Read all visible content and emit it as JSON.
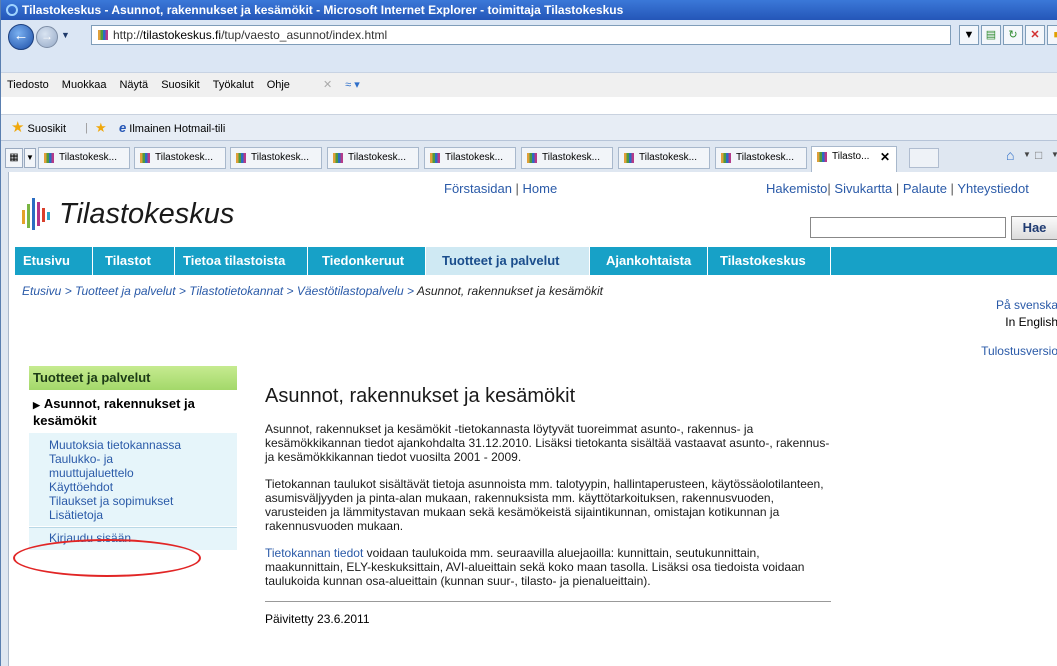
{
  "window": {
    "title": "Tilastokeskus - Asunnot, rakennukset ja kesämökit - Microsoft Internet Explorer - toimittaja Tilastokeskus"
  },
  "address": {
    "url_prefix": "http://",
    "url_domain": "tilastokeskus.fi",
    "url_path": "/tup/vaesto_asunnot/index.html"
  },
  "menu": [
    "Tiedosto",
    "Muokkaa",
    "Näytä",
    "Suosikit",
    "Työkalut",
    "Ohje"
  ],
  "favorites_bar": {
    "favorites_label": "Suosikit",
    "hotmail_label": "Ilmainen Hotmail-tili"
  },
  "tabs": [
    {
      "label": "Tilastokesk..."
    },
    {
      "label": "Tilastokesk..."
    },
    {
      "label": "Tilastokesk..."
    },
    {
      "label": "Tilastokesk..."
    },
    {
      "label": "Tilastokesk..."
    },
    {
      "label": "Tilastokesk..."
    },
    {
      "label": "Tilastokesk..."
    },
    {
      "label": "Tilastokesk..."
    },
    {
      "label": "Tilasto..."
    }
  ],
  "site": {
    "logo_text": "Tilastokeskus",
    "top_links": {
      "forstasidan": "Förstasidan",
      "home": "Home"
    },
    "right_links": [
      "Hakemisto",
      "Sivukartta",
      "Palaute",
      "Yhteystiedot"
    ],
    "search_button": "Hae",
    "nav": [
      "Etusivu",
      "Tilastot",
      "Tietoa tilastoista",
      "Tiedonkeruut",
      "Tuotteet ja palvelut",
      "Ajankohtaista",
      "Tilastokeskus"
    ],
    "nav_active": "Tuotteet ja palvelut"
  },
  "breadcrumb": {
    "links": [
      "Etusivu",
      "Tuotteet ja palvelut",
      "Tilastotietokannat",
      "Väestötilastopalvelu"
    ],
    "current": "Asunnot, rakennukset ja kesämökit"
  },
  "lang": {
    "sv": "På svenska",
    "en": "In English",
    "print": "Tulostusversio"
  },
  "sidebar": {
    "heading": "Tuotteet ja palvelut",
    "current": "Asunnot, rakennukset ja kesämökit",
    "items": [
      "Muutoksia tietokannassa",
      "Taulukko- ja muuttujaluettelo",
      "Käyttöehdot",
      "Tilaukset ja sopimukset",
      "Lisätietoja"
    ],
    "login": "Kirjaudu sisään"
  },
  "content": {
    "title": "Asunnot, rakennukset ja kesämökit",
    "p1": "Asunnot, rakennukset ja kesämökit -tietokannasta löytyvät tuoreimmat asunto-, rakennus- ja kesämökkikannan tiedot ajankohdalta 31.12.2010. Lisäksi tietokanta sisältää vastaavat asunto-, rakennus- ja kesämökkikannan tiedot vuosilta 2001 - 2009.",
    "p2": "Tietokannan taulukot sisältävät tietoja asunnoista mm. talotyypin, hallintaperusteen, käytössäolotilanteen, asumisväljyyden ja pinta-alan mukaan, rakennuksista mm. käyttötarkoituksen, rakennusvuoden, varusteiden ja lämmitystavan mukaan sekä kesämökeistä sijaintikunnan, omistajan kotikunnan ja rakennusvuoden mukaan.",
    "p3_link": "Tietokannan tiedot",
    "p3_rest": " voidaan taulukoida mm. seuraavilla aluejaoilla: kunnittain, seutukunnittain, maakunnittain, ELY-keskuksittain, AVI-alueittain sekä koko maan tasolla. Lisäksi osa tiedoista voidaan taulukoida kunnan osa-alueittain (kunnan suur-, tilasto- ja pienalueittain).",
    "updated": "Päivitetty 23.6.2011"
  }
}
